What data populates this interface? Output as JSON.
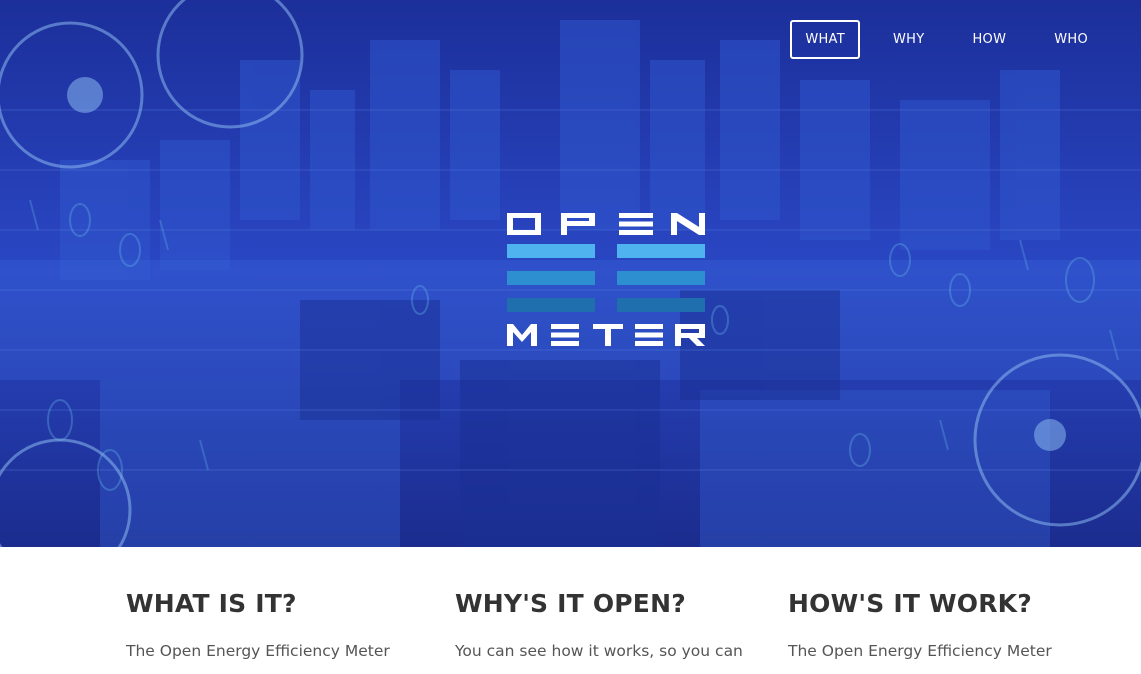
{
  "nav": {
    "items": [
      {
        "label": "WHAT",
        "active": true
      },
      {
        "label": "WHY",
        "active": false
      },
      {
        "label": "HOW",
        "active": false
      },
      {
        "label": "WHO",
        "active": false
      }
    ]
  },
  "logo": {
    "top_text": "OPEN",
    "bottom_text": "METER"
  },
  "sections": [
    {
      "title": "WHAT IS IT?",
      "text": "The Open Energy Efficiency Meter"
    },
    {
      "title": "WHY'S IT OPEN?",
      "text": "You can see how it works, so you can"
    },
    {
      "title": "HOW'S IT WORK?",
      "text": "The Open Energy Efficiency Meter"
    }
  ],
  "colors": {
    "hero_blue": "#243fb8",
    "logo_light": "#4fb3f0",
    "logo_mid": "#2e8fd0",
    "logo_dark": "#1f6fae",
    "heading": "#333333",
    "body_text": "#555555"
  }
}
